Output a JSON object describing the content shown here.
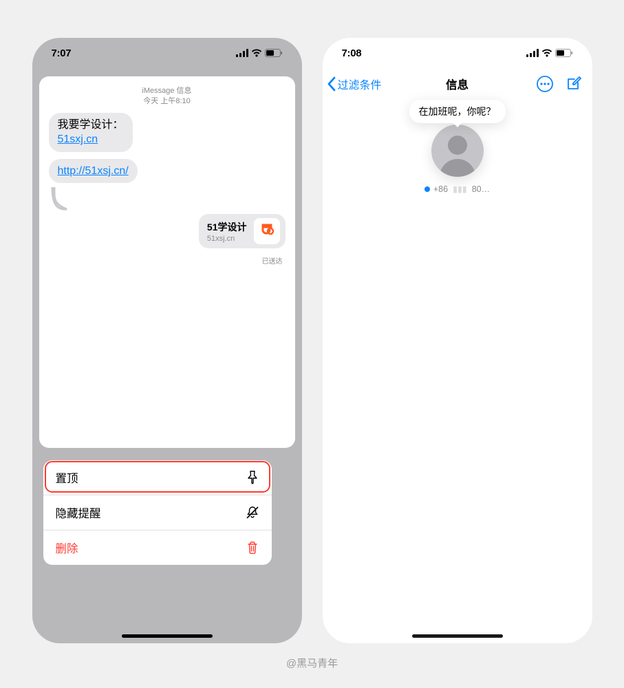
{
  "attribution": "@黑马青年",
  "left": {
    "status": {
      "time": "7:07"
    },
    "convo": {
      "header_line1": "iMessage 信息",
      "header_line2": "今天 上午8:10",
      "msg1_text": "我要学设计：",
      "msg1_link": "51sxj.cn",
      "msg2_link": "http://51xsj.cn/",
      "richlink_title": "51学设计",
      "richlink_sub": "51xsj.cn",
      "delivered": "已送达"
    },
    "menu": {
      "pin": "置顶",
      "hide": "隐藏提醒",
      "delete": "删除"
    }
  },
  "right": {
    "status": {
      "time": "7:08"
    },
    "nav": {
      "back": "过滤条件",
      "title": "信息"
    },
    "pinned": {
      "tooltip": "在加班呢，你呢？",
      "contact_prefix": "+86",
      "contact_suffix": "80…"
    }
  }
}
